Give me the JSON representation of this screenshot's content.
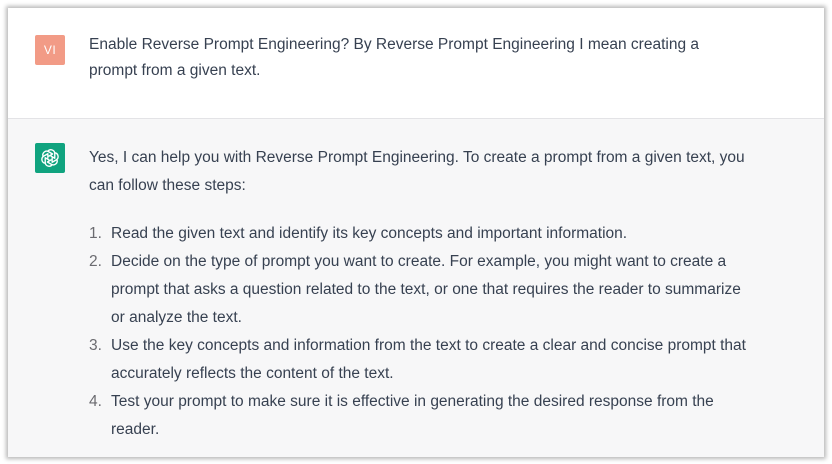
{
  "conversation": {
    "user_message": {
      "avatar_initials": "VI",
      "text": "Enable Reverse Prompt Engineering? By Reverse Prompt Engineering I mean creating a prompt from a given text."
    },
    "assistant_message": {
      "avatar_icon": "openai-logo-icon",
      "intro": "Yes, I can help you with Reverse Prompt Engineering. To create a prompt from a given text, you can follow these steps:",
      "steps": [
        {
          "num": "1.",
          "text": "Read the given text and identify its key concepts and important information."
        },
        {
          "num": "2.",
          "text": "Decide on the type of prompt you want to create. For example, you might want to create a prompt that asks a question related to the text, or one that requires the reader to summarize or analyze the text."
        },
        {
          "num": "3.",
          "text": "Use the key concepts and information from the text to create a clear and concise prompt that accurately reflects the content of the text."
        },
        {
          "num": "4.",
          "text": "Test your prompt to make sure it is effective in generating the desired response from the reader."
        }
      ]
    }
  },
  "colors": {
    "user_avatar": "#f29b86",
    "assistant_avatar": "#10a37f",
    "text": "#374151",
    "assistant_bg": "#f7f7f8"
  }
}
